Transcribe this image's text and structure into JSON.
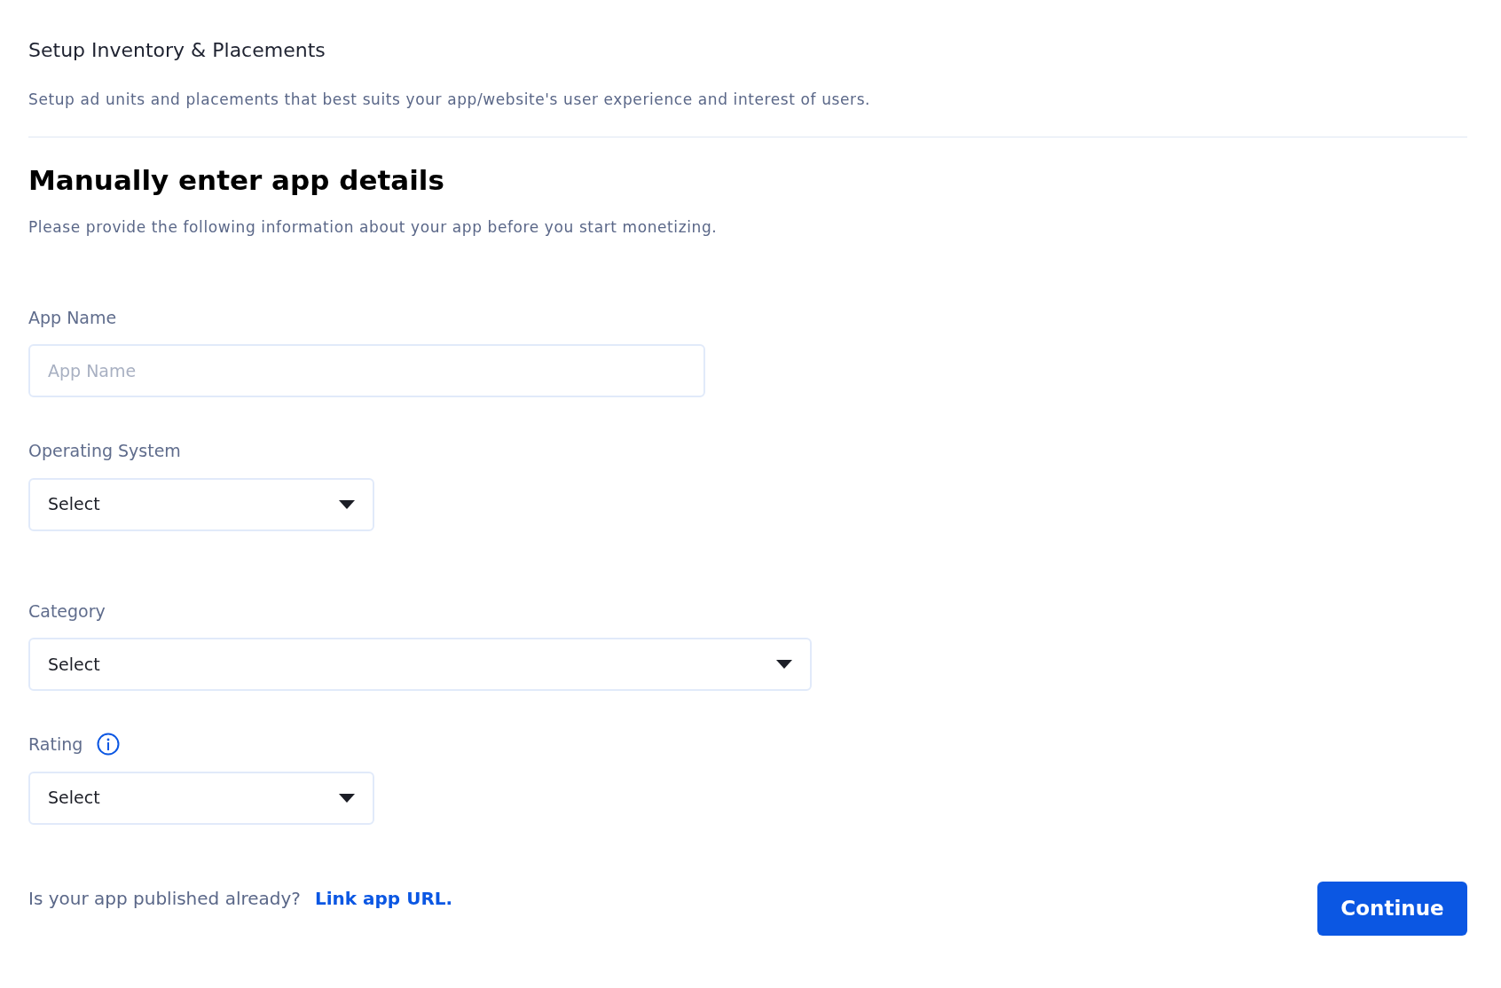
{
  "header": {
    "title": "Setup Inventory & Placements",
    "subtitle": "Setup ad units and placements that best suits your app/website's user experience and interest of users."
  },
  "form": {
    "heading": "Manually enter app details",
    "description": "Please provide the following information about your app before you start monetizing.",
    "fields": [
      {
        "label": "App Name",
        "kind": "input",
        "placeholder": "App Name",
        "info": false
      },
      {
        "label": "Operating System",
        "kind": "select",
        "value": "Select",
        "info": false
      },
      {
        "label": "Category",
        "kind": "select",
        "value": "Select",
        "info": false
      },
      {
        "label": "Rating",
        "kind": "select",
        "value": "Select",
        "info": true
      }
    ]
  },
  "footer": {
    "question": "Is your app published already?",
    "link": "Link app URL.",
    "button": "Continue"
  }
}
